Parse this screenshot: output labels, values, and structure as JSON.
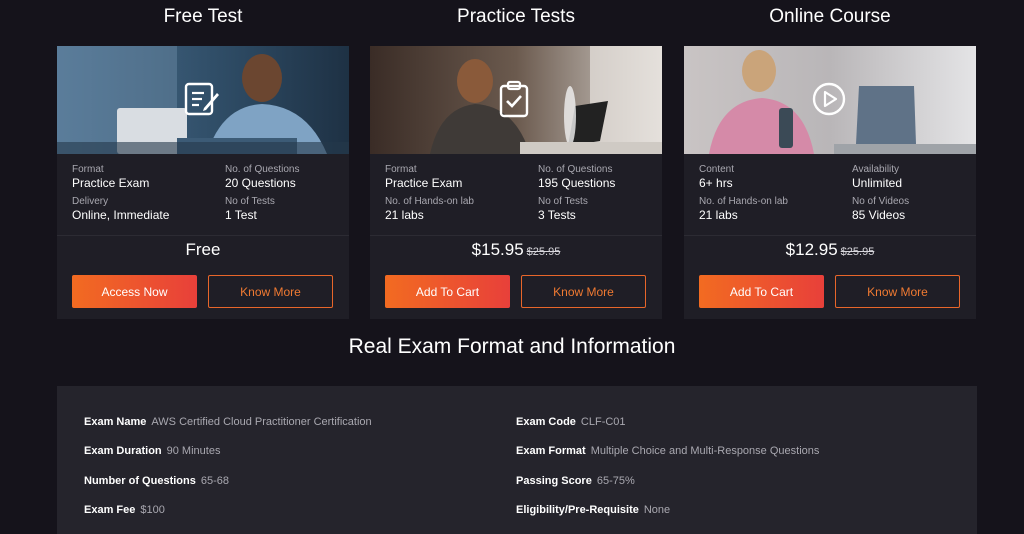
{
  "columns": [
    {
      "title": "Free Test",
      "icon": "edit-icon",
      "info": [
        {
          "label": "Format",
          "value": "Practice Exam"
        },
        {
          "label": "No. of Questions",
          "value": "20 Questions"
        },
        {
          "label": "Delivery",
          "value": "Online, Immediate"
        },
        {
          "label": "No of Tests",
          "value": "1 Test"
        }
      ],
      "price": "Free",
      "old_price": "",
      "primary_button": "Access Now",
      "secondary_button": "Know More"
    },
    {
      "title": "Practice Tests",
      "icon": "clipboard-check-icon",
      "info": [
        {
          "label": "Format",
          "value": "Practice Exam"
        },
        {
          "label": "No. of Questions",
          "value": "195 Questions"
        },
        {
          "label": "No. of Hands-on lab",
          "value": "21 labs"
        },
        {
          "label": "No of Tests",
          "value": "3 Tests"
        }
      ],
      "price": "$15.95",
      "old_price": "$25.95",
      "primary_button": "Add To Cart",
      "secondary_button": "Know More"
    },
    {
      "title": "Online Course",
      "icon": "play-circle-icon",
      "info": [
        {
          "label": "Content",
          "value": "6+ hrs"
        },
        {
          "label": "Availability",
          "value": "Unlimited"
        },
        {
          "label": "No. of Hands-on lab",
          "value": "21 labs"
        },
        {
          "label": "No of Videos",
          "value": "85 Videos"
        }
      ],
      "price": "$12.95",
      "old_price": "$25.95",
      "primary_button": "Add To Cart",
      "secondary_button": "Know More"
    }
  ],
  "exam_section": {
    "title": "Real Exam Format and Information",
    "rows": [
      {
        "key": "Exam Name",
        "value": "AWS Certified Cloud Practitioner Certification"
      },
      {
        "key": "Exam Code",
        "value": "CLF-C01"
      },
      {
        "key": "Exam Duration",
        "value": "90 Minutes"
      },
      {
        "key": "Exam Format",
        "value": "Multiple Choice and Multi-Response Questions"
      },
      {
        "key": "Number of Questions",
        "value": "65-68"
      },
      {
        "key": "Passing Score",
        "value": "65-75%"
      },
      {
        "key": "Exam Fee",
        "value": "$100"
      },
      {
        "key": "Eligibility/Pre-Requisite",
        "value": "None"
      }
    ]
  },
  "colors": {
    "background": "#15131b",
    "card": "#1f1e26",
    "accent_start": "#f26b21",
    "accent_end": "#e8403a",
    "muted_text": "#a9a8b0"
  }
}
